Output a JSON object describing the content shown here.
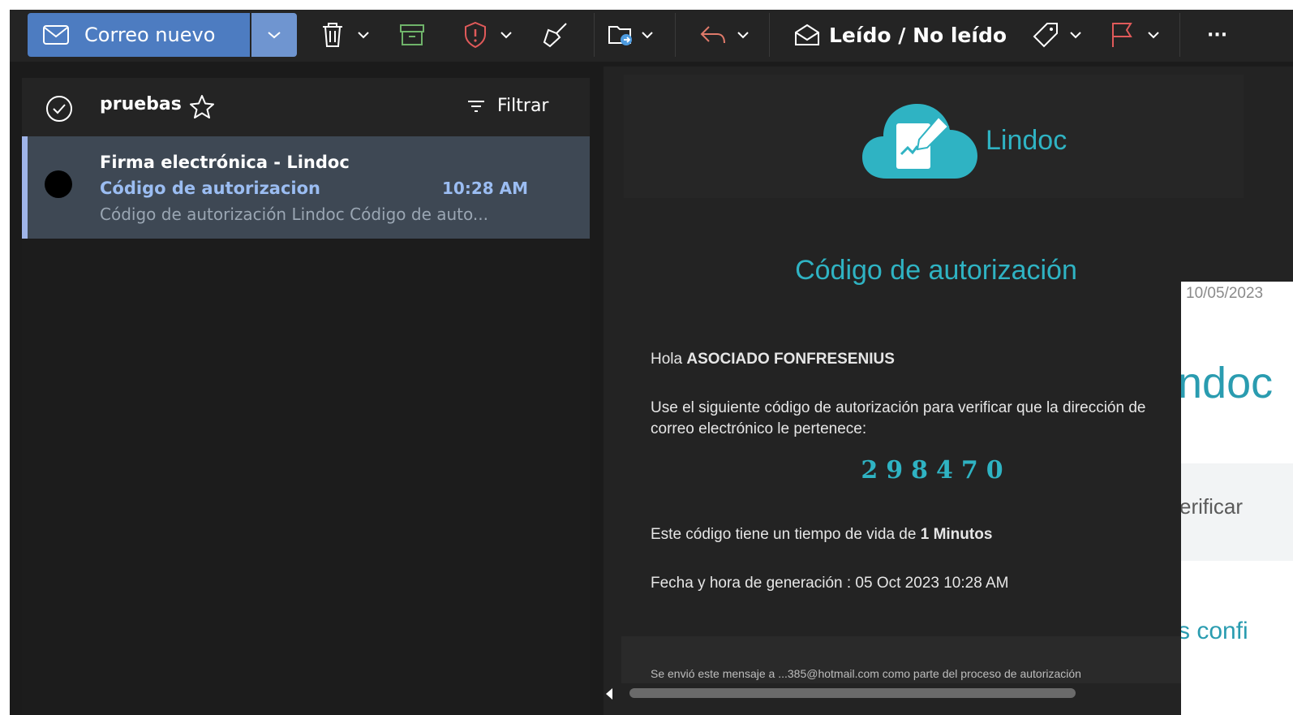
{
  "toolbar": {
    "new_mail_label": "Correo nuevo",
    "read_unread_label": "Leído / No leído",
    "more_label": "···",
    "colors": {
      "accent": "#4d7cc1",
      "archive": "#6fb36a",
      "report": "#e05a5a",
      "flag": "#e05a5a"
    }
  },
  "folder": {
    "name": "pruebas",
    "filter_label": "Filtrar"
  },
  "messages": [
    {
      "from": "Firma electrónica - Lindoc",
      "subject": "Código de autorizacion",
      "time": "10:28 AM",
      "preview": "Código de autorización Lindoc Código de auto..."
    }
  ],
  "email": {
    "brand": "Lindoc",
    "title": "Código de autorización",
    "greeting_prefix": "Hola ",
    "greeting_name": "ASOCIADO FONFRESENIUS",
    "instruction_line1": "Use el siguiente código de autorización para verificar que la dirección de",
    "instruction_line2": "correo electrónico le pertenece:",
    "code": "298470",
    "lifetime_prefix": "Este código tiene un tiempo de vida de ",
    "lifetime_value": "1 Minutos",
    "generated": "Fecha y hora de generación : 05 Oct 2023 10:28 AM",
    "footer": "Se envió este mensaje a ...385@hotmail.com como parte del proceso de autorización",
    "accent_color": "#2fb3c3"
  },
  "overlay_window": {
    "date": "10/05/2023",
    "brand_fragment": "ndoc",
    "verify_fragment": "erificar",
    "confirm_fragment": "s confi"
  }
}
